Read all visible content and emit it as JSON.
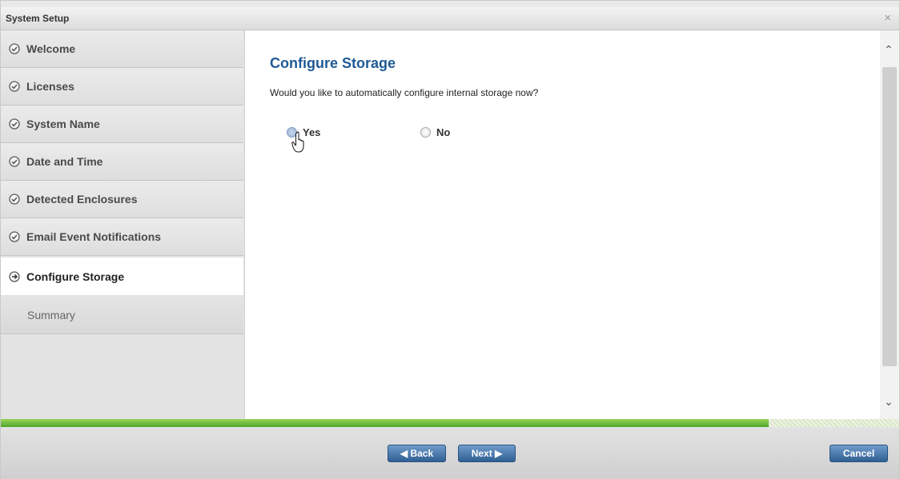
{
  "window": {
    "title": "System Setup",
    "close_glyph": "×"
  },
  "sidebar": {
    "steps": [
      {
        "label": "Welcome",
        "state": "completed"
      },
      {
        "label": "Licenses",
        "state": "completed"
      },
      {
        "label": "System Name",
        "state": "completed"
      },
      {
        "label": "Date and Time",
        "state": "completed"
      },
      {
        "label": "Detected Enclosures",
        "state": "completed"
      },
      {
        "label": "Email Event Notifications",
        "state": "completed"
      },
      {
        "label": "Configure Storage",
        "state": "current"
      },
      {
        "label": "Summary",
        "state": "pending"
      }
    ]
  },
  "main": {
    "heading": "Configure Storage",
    "question": "Would you like to automatically configure internal storage now?",
    "options": [
      {
        "label": "Yes",
        "selected": true
      },
      {
        "label": "No",
        "selected": false
      }
    ]
  },
  "progress": {
    "fraction": 0.855
  },
  "footer": {
    "back_label": "◀ Back",
    "next_label": "Next ▶",
    "cancel_label": "Cancel"
  },
  "colors": {
    "accent": "#1f5a95",
    "button": "#3b6b9f",
    "progress": "#5cb034",
    "check": "#5a5a5a"
  },
  "icons": {
    "completed": "check-circle-icon",
    "current": "arrow-circle-icon",
    "cursor": "hand-pointer-icon"
  }
}
